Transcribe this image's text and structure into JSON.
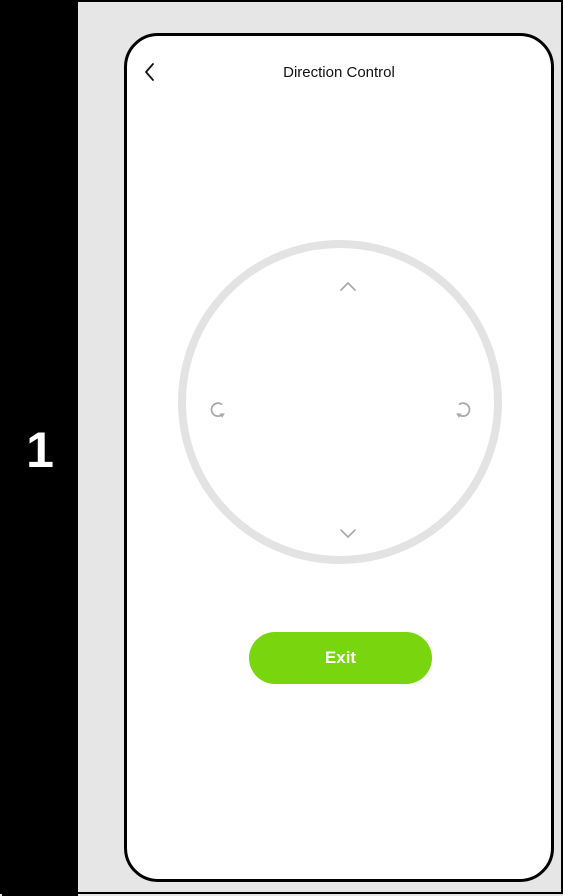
{
  "step": {
    "number": "1"
  },
  "header": {
    "title": "Direction Control",
    "back_icon": "chevron-left-icon"
  },
  "joystick": {
    "up_icon": "chevron-up-icon",
    "down_icon": "chevron-down-icon",
    "left_icon": "rotate-counterclockwise-icon",
    "right_icon": "rotate-clockwise-icon",
    "ring_color": "#e3e3e3",
    "icon_color": "#a8a8a8"
  },
  "exit": {
    "label": "Exit",
    "color": "#78d50e"
  }
}
